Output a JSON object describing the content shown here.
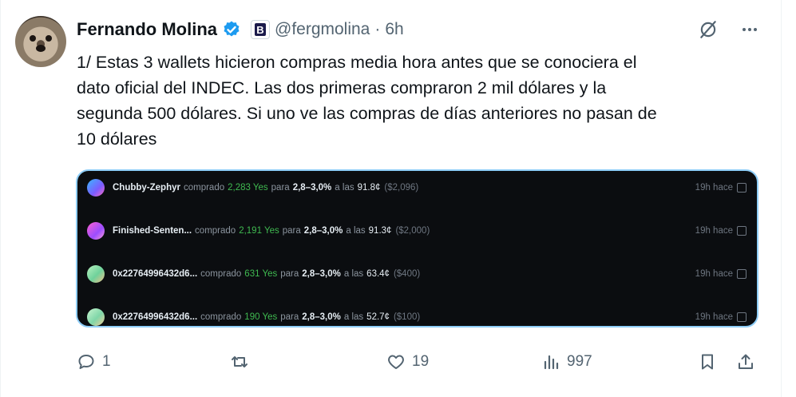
{
  "tweet": {
    "author_name": "Fernando Molina",
    "brand_badge": "B",
    "handle": "@fergmolina",
    "separator": "·",
    "time": "6h",
    "text_lines": [
      "1/ Estas 3 wallets hicieron compras media hora antes que se conociera el",
      "dato oficial del INDEC. Las dos primeras compraron 2 mil dólares y la",
      "segunda 500 dólares. Si uno ve las compras de días anteriores no pasan de",
      "10 dólares"
    ]
  },
  "media": {
    "rows": [
      {
        "wallet": "Chubby-Zephyr",
        "action": "comprado",
        "shares": "2,283 Yes",
        "prep": "para",
        "range": "2,8–3,0%",
        "at": "a las",
        "price": "91.8¢",
        "usd": "($2,096)",
        "ago": "19h hace",
        "avatar_color": "#4aa3ff"
      },
      {
        "wallet": "Finished-Senten...",
        "action": "comprado",
        "shares": "2,191 Yes",
        "prep": "para",
        "range": "2,8–3,0%",
        "at": "a las",
        "price": "91.3¢",
        "usd": "($2,000)",
        "ago": "19h hace",
        "avatar_color": "#c04ad8"
      },
      {
        "wallet": "0x22764996432d6...",
        "action": "comprado",
        "shares": "631 Yes",
        "prep": "para",
        "range": "2,8–3,0%",
        "at": "a las",
        "price": "63.4¢",
        "usd": "($400)",
        "ago": "19h hace",
        "avatar_color": "#9bd4a0"
      },
      {
        "wallet": "0x22764996432d6...",
        "action": "comprado",
        "shares": "190 Yes",
        "prep": "para",
        "range": "2,8–3,0%",
        "at": "a las",
        "price": "52.7¢",
        "usd": "($100)",
        "ago": "19h hace",
        "avatar_color": "#a8d8b0"
      }
    ]
  },
  "actions": {
    "replies": "1",
    "retweets": "",
    "likes": "19",
    "views": "997"
  },
  "colors": {
    "accent": "#1d9bf0",
    "muted": "#536471",
    "green": "#3fb950",
    "media_bg": "#0b0d10"
  },
  "icons": [
    "verified-icon",
    "grok-icon",
    "more-icon",
    "reply-icon",
    "retweet-icon",
    "like-icon",
    "views-icon",
    "bookmark-icon",
    "share-icon",
    "external-link-icon"
  ]
}
